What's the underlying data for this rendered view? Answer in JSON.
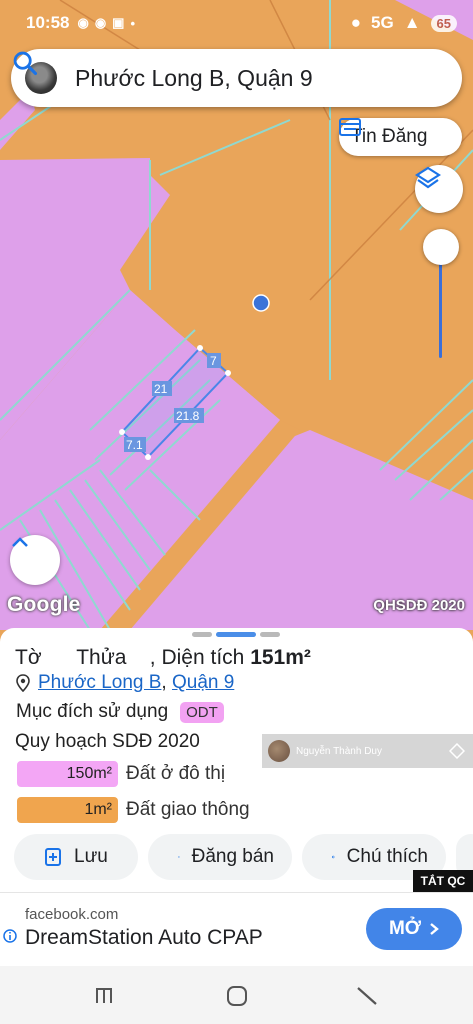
{
  "status_bar": {
    "time": "10:58",
    "signal_label": "5G",
    "battery": "65"
  },
  "search": {
    "text": "Phước Long B, Quận 9"
  },
  "map": {
    "tin_dang_label": "Tin Đăng",
    "google_label": "Google",
    "layer_label": "QHSDĐ 2020",
    "dimensions": [
      "7",
      "21",
      "21.8",
      "7.1"
    ],
    "colors": {
      "residential": "#dea0ea",
      "transport": "#e9a55a",
      "parcel_line": "#8fd9d0",
      "selected": "#4a86e8"
    }
  },
  "sheet": {
    "title_prefix": "Tờ      Thửa    , Diện tích ",
    "area": "151m²",
    "ward_link": "Phước Long B",
    "district_link": "Quận 9",
    "purpose_label": "Mục đích sử dụng",
    "purpose_code": "ODT",
    "plan_label": "Quy hoạch SDĐ 2020",
    "watermark_name": "Nguyễn Thành Duy",
    "legend": [
      {
        "value": "150m²",
        "label": "Đất ở đô thị",
        "color": "#f3a6f5"
      },
      {
        "value": "1m²",
        "label": "Đất giao thông",
        "color": "#f0a54e"
      }
    ],
    "actions": {
      "save": "Lưu",
      "post": "Đăng bán",
      "legend": "Chú thích"
    }
  },
  "ad": {
    "close_label": "TẮT QC",
    "domain": "facebook.com",
    "title": "DreamStation Auto CPAP",
    "cta": "MỞ"
  }
}
